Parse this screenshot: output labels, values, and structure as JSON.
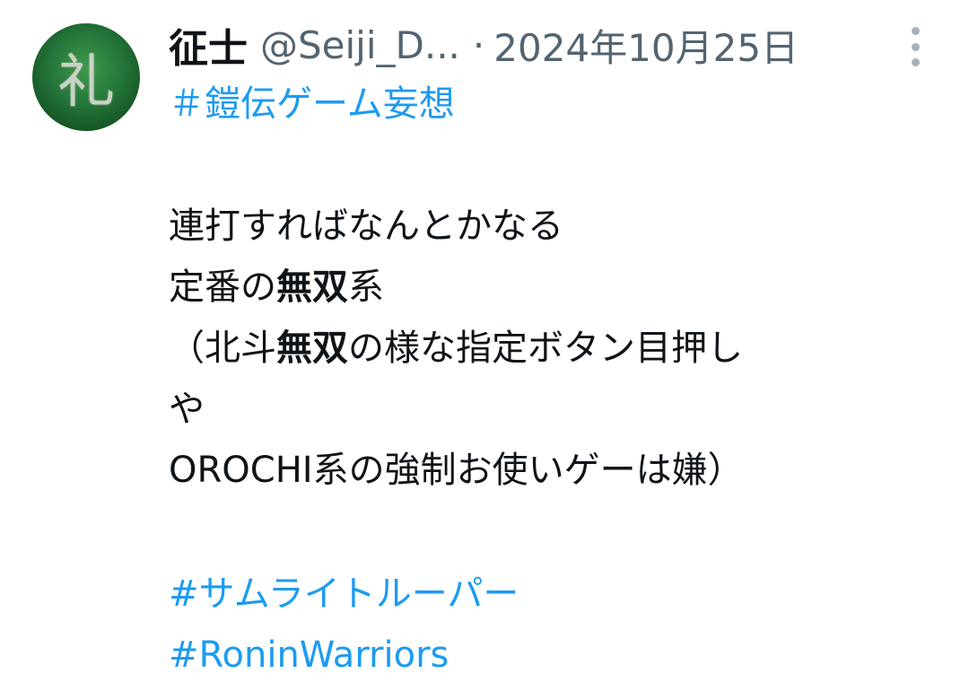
{
  "tweet": {
    "display_name": "征士",
    "handle": "@Seiji_D...",
    "separator": "·",
    "date": "2024年10月25日",
    "more_icon": "more-vertical-icon",
    "avatar_glyph": "礼",
    "hashtag_top": "＃鎧伝ゲーム妄想",
    "lines": {
      "l1": "連打すればなんとかなる",
      "l2a": "定番の",
      "l2b": "無双",
      "l2c": "系",
      "l3a": "（北斗",
      "l3b": "無双",
      "l3c": "の様な指定ボタン目押し",
      "l4": "や",
      "l5": "OROCHI系の強制お使いゲーは嫌）"
    },
    "hashtag_1": "#サムライトルーパー",
    "hashtag_2": "#RoninWarriors"
  },
  "colors": {
    "link": "#1d9bf0",
    "secondary": "#536471",
    "text": "#0f1419"
  }
}
